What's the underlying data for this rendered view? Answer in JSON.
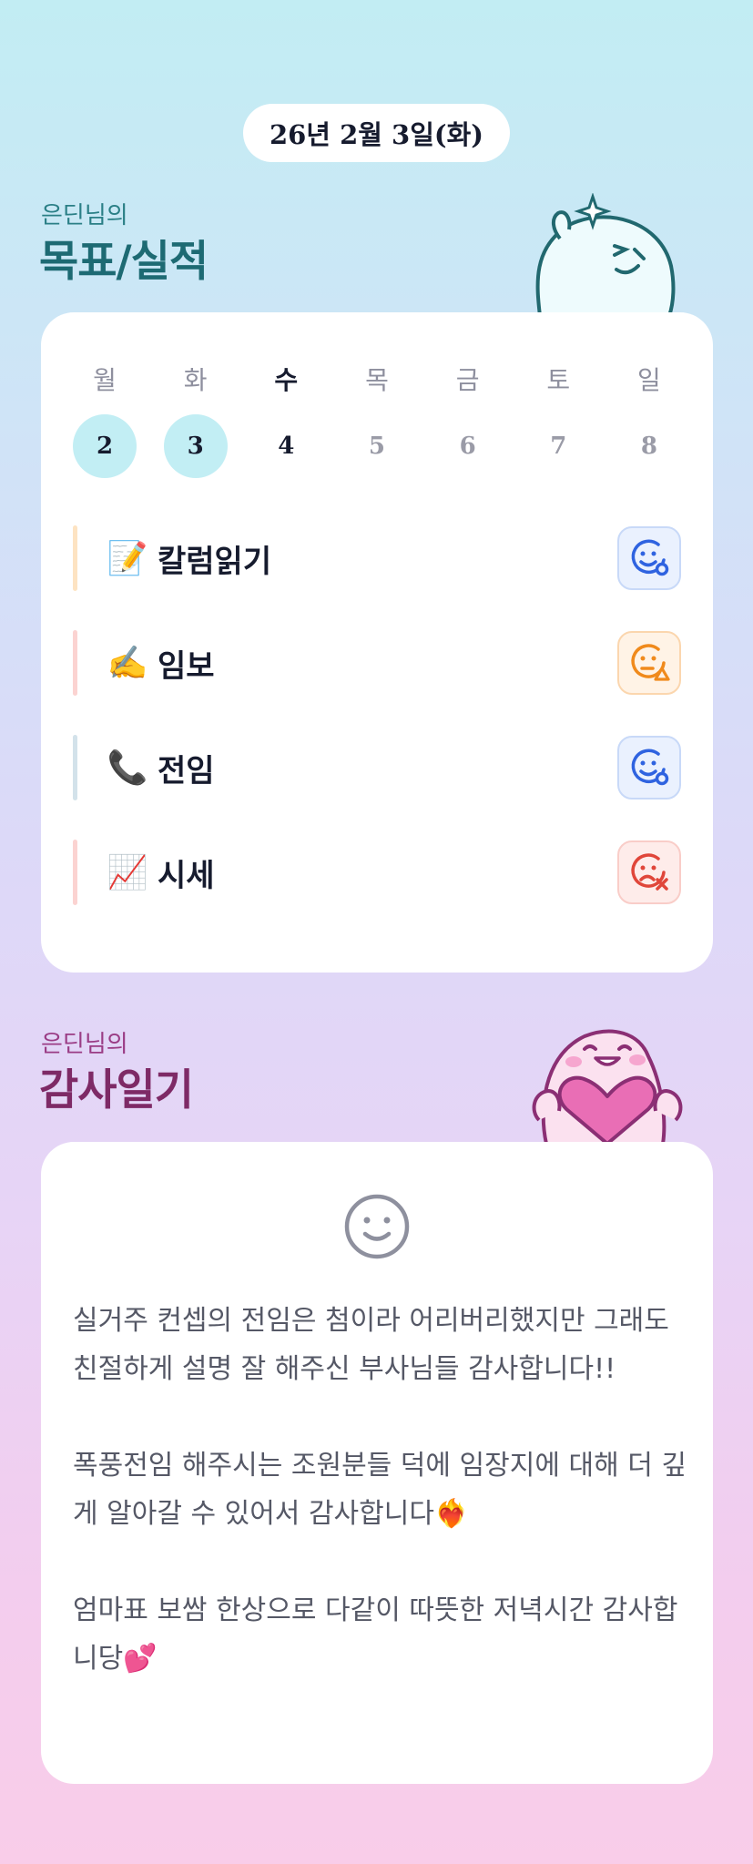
{
  "date": "26년 2월 3일(화)",
  "goal_section": {
    "subtitle": "은딘님의",
    "title": "목표/실적"
  },
  "week": {
    "days": [
      {
        "name": "월",
        "num": "2",
        "state": "done"
      },
      {
        "name": "화",
        "num": "3",
        "state": "done"
      },
      {
        "name": "수",
        "num": "4",
        "state": "today"
      },
      {
        "name": "목",
        "num": "5",
        "state": "future"
      },
      {
        "name": "금",
        "num": "6",
        "state": "future"
      },
      {
        "name": "토",
        "num": "7",
        "state": "future"
      },
      {
        "name": "일",
        "num": "8",
        "state": "future"
      }
    ]
  },
  "goals": [
    {
      "emoji": "📝",
      "label": "칼럼읽기",
      "bar_color": "#fde3c2",
      "status": "good",
      "status_icon": "smile-check-icon"
    },
    {
      "emoji": "✍️",
      "label": "임보",
      "bar_color": "#fbd3d1",
      "status": "mid",
      "status_icon": "neutral-warning-icon"
    },
    {
      "emoji": "📞",
      "label": "전임",
      "bar_color": "#d3e2ea",
      "status": "good",
      "status_icon": "smile-check-icon"
    },
    {
      "emoji": "📈",
      "label": "시세",
      "bar_color": "#fbd3d1",
      "status": "bad",
      "status_icon": "sad-x-icon"
    }
  ],
  "diary_section": {
    "subtitle": "은딘님의",
    "title": "감사일기"
  },
  "diary": {
    "mood_icon": "smile-face-icon",
    "text": "실거주 컨셉의 전임은 첨이라 어리버리했지만 그래도 친절하게 설명 잘 해주신 부사님들 감사합니다!!\n\n폭풍전임 해주시는 조원분들 덕에 임장지에 대해 더 깊게 알아갈 수 있어서 감사합니다❤️‍🔥\n\n엄마표 보쌈 한상으로 다같이 따뜻한 저녁시간 감사합니당💕"
  },
  "colors": {
    "goal_title": "#1d6a73",
    "diary_title": "#7e2a66",
    "status_good": "#2f63e0",
    "status_mid": "#f08a1c",
    "status_bad": "#e0463a"
  }
}
